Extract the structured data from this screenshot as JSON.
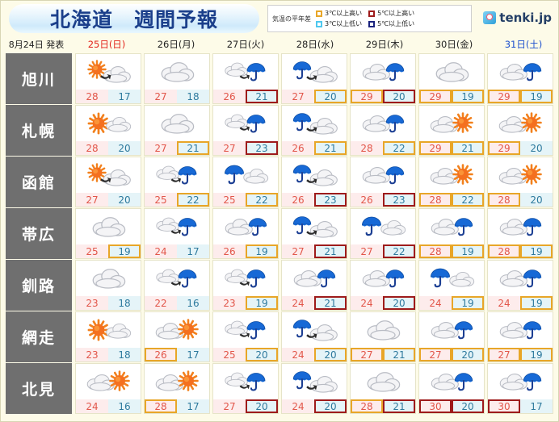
{
  "header": {
    "title": "北海道　週間予報",
    "legend_title": "気温の平年差",
    "legend": [
      {
        "label": "3℃以上高い",
        "color": "#e8a628"
      },
      {
        "label": "5℃以上高い",
        "color": "#9e1b1b"
      },
      {
        "label": "3℃以上低い",
        "color": "#4ec8ef"
      },
      {
        "label": "5℃以上低い",
        "color": "#1a237e"
      }
    ],
    "logo_text": "tenki.jp"
  },
  "dates": {
    "announced": "8月24日 発表",
    "days": [
      {
        "label": "25日(日)",
        "type": "sun"
      },
      {
        "label": "26日(月)",
        "type": "weekday"
      },
      {
        "label": "27日(火)",
        "type": "weekday"
      },
      {
        "label": "28日(水)",
        "type": "weekday"
      },
      {
        "label": "29日(木)",
        "type": "weekday"
      },
      {
        "label": "30日(金)",
        "type": "weekday"
      },
      {
        "label": "31日(土)",
        "type": "sat"
      }
    ]
  },
  "rows": [
    {
      "city": "旭川",
      "cells": [
        {
          "icon": "sun-then-cloud",
          "max": "28",
          "min": "17",
          "max_mark": "",
          "min_mark": ""
        },
        {
          "icon": "cloud",
          "max": "27",
          "min": "18",
          "max_mark": "",
          "min_mark": ""
        },
        {
          "icon": "cloud-then-rain",
          "max": "26",
          "min": "21",
          "max_mark": "",
          "min_mark": "hi5"
        },
        {
          "icon": "rain-then-cloud",
          "max": "27",
          "min": "20",
          "max_mark": "",
          "min_mark": "hi3"
        },
        {
          "icon": "cloud-rain",
          "max": "29",
          "min": "20",
          "max_mark": "hi3",
          "min_mark": "hi5"
        },
        {
          "icon": "cloud",
          "max": "29",
          "min": "19",
          "max_mark": "hi3",
          "min_mark": "hi3"
        },
        {
          "icon": "cloud-rain",
          "max": "29",
          "min": "19",
          "max_mark": "hi3",
          "min_mark": "hi3"
        }
      ]
    },
    {
      "city": "札幌",
      "cells": [
        {
          "icon": "sun-cloud",
          "max": "28",
          "min": "20",
          "max_mark": "",
          "min_mark": ""
        },
        {
          "icon": "cloud",
          "max": "27",
          "min": "21",
          "max_mark": "",
          "min_mark": "hi3"
        },
        {
          "icon": "cloud-then-rain",
          "max": "27",
          "min": "23",
          "max_mark": "",
          "min_mark": "hi5"
        },
        {
          "icon": "rain-then-cloud",
          "max": "26",
          "min": "21",
          "max_mark": "",
          "min_mark": "hi3"
        },
        {
          "icon": "cloud-rain",
          "max": "28",
          "min": "22",
          "max_mark": "",
          "min_mark": "hi3"
        },
        {
          "icon": "cloud-sun",
          "max": "29",
          "min": "21",
          "max_mark": "hi3",
          "min_mark": "hi3"
        },
        {
          "icon": "cloud-sun",
          "max": "29",
          "min": "20",
          "max_mark": "hi3",
          "min_mark": ""
        }
      ]
    },
    {
      "city": "函館",
      "cells": [
        {
          "icon": "sun-then-cloud",
          "max": "27",
          "min": "20",
          "max_mark": "",
          "min_mark": ""
        },
        {
          "icon": "cloud-then-rain",
          "max": "25",
          "min": "22",
          "max_mark": "",
          "min_mark": "hi3"
        },
        {
          "icon": "rain-cloud",
          "max": "25",
          "min": "22",
          "max_mark": "",
          "min_mark": "hi3"
        },
        {
          "icon": "rain-then-cloud",
          "max": "26",
          "min": "23",
          "max_mark": "",
          "min_mark": "hi5"
        },
        {
          "icon": "cloud-rain",
          "max": "26",
          "min": "23",
          "max_mark": "",
          "min_mark": "hi5"
        },
        {
          "icon": "cloud-sun",
          "max": "28",
          "min": "22",
          "max_mark": "hi3",
          "min_mark": "hi3"
        },
        {
          "icon": "cloud-sun",
          "max": "28",
          "min": "20",
          "max_mark": "hi3",
          "min_mark": ""
        }
      ]
    },
    {
      "city": "帯広",
      "cells": [
        {
          "icon": "cloud",
          "max": "25",
          "min": "19",
          "max_mark": "",
          "min_mark": "hi3"
        },
        {
          "icon": "cloud-then-rain",
          "max": "24",
          "min": "17",
          "max_mark": "",
          "min_mark": ""
        },
        {
          "icon": "cloud-rain",
          "max": "26",
          "min": "19",
          "max_mark": "",
          "min_mark": "hi3"
        },
        {
          "icon": "rain-then-cloud",
          "max": "27",
          "min": "21",
          "max_mark": "",
          "min_mark": "hi5"
        },
        {
          "icon": "rain-cloud",
          "max": "27",
          "min": "22",
          "max_mark": "",
          "min_mark": "hi5"
        },
        {
          "icon": "cloud-rain",
          "max": "28",
          "min": "19",
          "max_mark": "hi3",
          "min_mark": "hi3"
        },
        {
          "icon": "cloud-rain",
          "max": "28",
          "min": "19",
          "max_mark": "hi3",
          "min_mark": "hi3"
        }
      ]
    },
    {
      "city": "釧路",
      "cells": [
        {
          "icon": "cloud",
          "max": "23",
          "min": "18",
          "max_mark": "",
          "min_mark": ""
        },
        {
          "icon": "cloud-then-rain",
          "max": "22",
          "min": "16",
          "max_mark": "",
          "min_mark": ""
        },
        {
          "icon": "cloud-then-rain",
          "max": "23",
          "min": "19",
          "max_mark": "",
          "min_mark": "hi3"
        },
        {
          "icon": "cloud-rain",
          "max": "24",
          "min": "21",
          "max_mark": "",
          "min_mark": "hi5"
        },
        {
          "icon": "cloud-rain",
          "max": "24",
          "min": "20",
          "max_mark": "",
          "min_mark": "hi5"
        },
        {
          "icon": "rain-cloud",
          "max": "24",
          "min": "19",
          "max_mark": "",
          "min_mark": "hi3"
        },
        {
          "icon": "cloud-rain",
          "max": "24",
          "min": "19",
          "max_mark": "",
          "min_mark": "hi3"
        }
      ]
    },
    {
      "city": "網走",
      "cells": [
        {
          "icon": "sun-cloud",
          "max": "23",
          "min": "18",
          "max_mark": "",
          "min_mark": ""
        },
        {
          "icon": "cloud-sun",
          "max": "26",
          "min": "17",
          "max_mark": "hi3",
          "min_mark": ""
        },
        {
          "icon": "cloud-then-rain",
          "max": "25",
          "min": "20",
          "max_mark": "",
          "min_mark": "hi3"
        },
        {
          "icon": "rain-then-cloud",
          "max": "24",
          "min": "20",
          "max_mark": "",
          "min_mark": "hi3"
        },
        {
          "icon": "cloud",
          "max": "27",
          "min": "21",
          "max_mark": "hi3",
          "min_mark": "hi3"
        },
        {
          "icon": "cloud-rain",
          "max": "27",
          "min": "20",
          "max_mark": "hi3",
          "min_mark": "hi3"
        },
        {
          "icon": "cloud-rain",
          "max": "27",
          "min": "19",
          "max_mark": "hi3",
          "min_mark": "hi3"
        }
      ]
    },
    {
      "city": "北見",
      "cells": [
        {
          "icon": "cloud-sun",
          "max": "24",
          "min": "16",
          "max_mark": "",
          "min_mark": ""
        },
        {
          "icon": "cloud-sun",
          "max": "28",
          "min": "17",
          "max_mark": "hi3",
          "min_mark": ""
        },
        {
          "icon": "cloud-then-rain",
          "max": "27",
          "min": "20",
          "max_mark": "",
          "min_mark": "hi5"
        },
        {
          "icon": "rain-then-cloud",
          "max": "24",
          "min": "20",
          "max_mark": "",
          "min_mark": "hi5"
        },
        {
          "icon": "cloud",
          "max": "28",
          "min": "21",
          "max_mark": "hi3",
          "min_mark": "hi5"
        },
        {
          "icon": "cloud-rain",
          "max": "30",
          "min": "20",
          "max_mark": "hi5",
          "min_mark": "hi5"
        },
        {
          "icon": "cloud-rain",
          "max": "30",
          "min": "17",
          "max_mark": "hi5",
          "min_mark": ""
        }
      ]
    }
  ]
}
